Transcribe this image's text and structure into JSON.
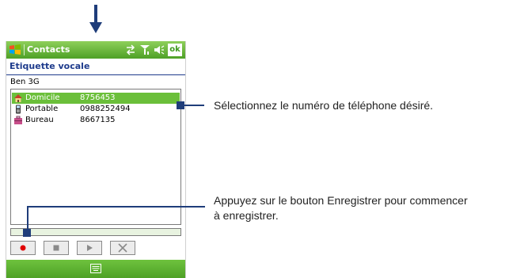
{
  "app_title": "Contacts",
  "screen_title": "Etiquette vocale",
  "ok_label": "ok",
  "contact_name": "Ben 3G",
  "phone_entries": [
    {
      "icon": "home-icon",
      "label": "Domicile",
      "number": "8756453",
      "selected": true
    },
    {
      "icon": "mobile-phone-icon",
      "label": "Portable",
      "number": "0988252494",
      "selected": false
    },
    {
      "icon": "office-icon",
      "label": "Bureau",
      "number": "8667135",
      "selected": false
    }
  ],
  "controls": [
    {
      "name": "record-button",
      "icon": "record-icon",
      "color": "#e00000"
    },
    {
      "name": "stop-button",
      "icon": "stop-icon"
    },
    {
      "name": "play-button",
      "icon": "play-icon"
    },
    {
      "name": "delete-button",
      "icon": "close-icon"
    }
  ],
  "callouts": {
    "select_number": "Sélectionnez le numéro de téléphone désiré.",
    "record_line1": "Appuyez sur le bouton Enregistrer pour commencer",
    "record_line2": "à enregistrer."
  },
  "colors": {
    "titlebar_green": "#4ea126",
    "selection_green": "#6bbf3a",
    "header_blue": "#1e3b8c",
    "callout_blue": "#1f3d7a"
  }
}
